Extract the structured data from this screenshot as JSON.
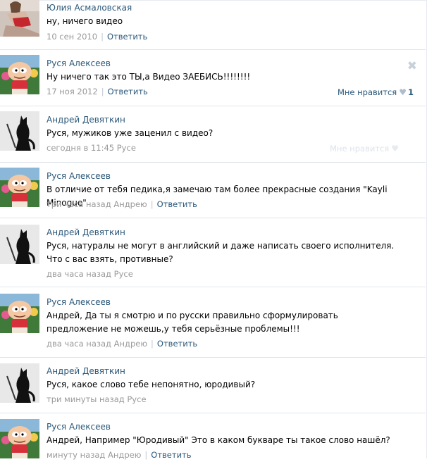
{
  "comments": [
    {
      "author": "Юлия Асмаловская",
      "avatar": "woman-photo",
      "text": "ну, ничего видео",
      "time": "10 сен 2010",
      "reply_to": "",
      "reply_label": "Ответить"
    },
    {
      "author": "Руся Алексеев",
      "avatar": "cartoon-baby",
      "text": "Ну ничего так это ТЫ,а Видео ЗАЕБИСЬ!!!!!!!!",
      "time": "17 ноя 2012",
      "reply_to": "",
      "reply_label": "Ответить",
      "like_label": "Мне нравится",
      "like_count": "1",
      "close": "✖"
    },
    {
      "author": "Андрей Девяткин",
      "avatar": "black-cat",
      "text": "Руся, мужиков уже заценил с видео?",
      "time": "сегодня в 11:45",
      "reply_to": "Русе",
      "reply_label": "",
      "like_label": "Мне нравится"
    },
    {
      "author": "Руся Алексеев",
      "avatar": "cartoon-baby",
      "text": "В отличие от тебя педика,я замечаю там более прекрасные создания \"Kayli Minogue\"",
      "time": "три часа назад",
      "reply_to": "Андрею",
      "reply_label": "Ответить"
    },
    {
      "author": "Андрей Девяткин",
      "avatar": "black-cat",
      "text": "Руся, натуралы не могут в английский и даже написать своего исполнителя. Что с вас взять, противные?",
      "time": "два часа назад",
      "reply_to": "Русе",
      "reply_label": ""
    },
    {
      "author": "Руся Алексеев",
      "avatar": "cartoon-baby",
      "text": "Андрей, Да ты я смотрю и по русски правильно сформулировать предложение не можешь,у тебя серьёзные проблемы!!!",
      "time": "два часа назад",
      "reply_to": "Андрею",
      "reply_label": "Ответить"
    },
    {
      "author": "Андрей Девяткин",
      "avatar": "black-cat",
      "text": "Руся, какое слово тебе непонятно, юродивый?",
      "time": "три минуты назад",
      "reply_to": "Русе",
      "reply_label": ""
    },
    {
      "author": "Руся Алексеев",
      "avatar": "cartoon-baby",
      "text": "Андрей, Например \"Юродивый\" Это в каком букваре ты такое слово нашёл?",
      "time": "минуту назад",
      "reply_to": "Андрею",
      "reply_label": "Ответить"
    }
  ],
  "colors": {
    "link": "#2b587a",
    "meta": "#999999",
    "divider": "#dfe4ea"
  }
}
